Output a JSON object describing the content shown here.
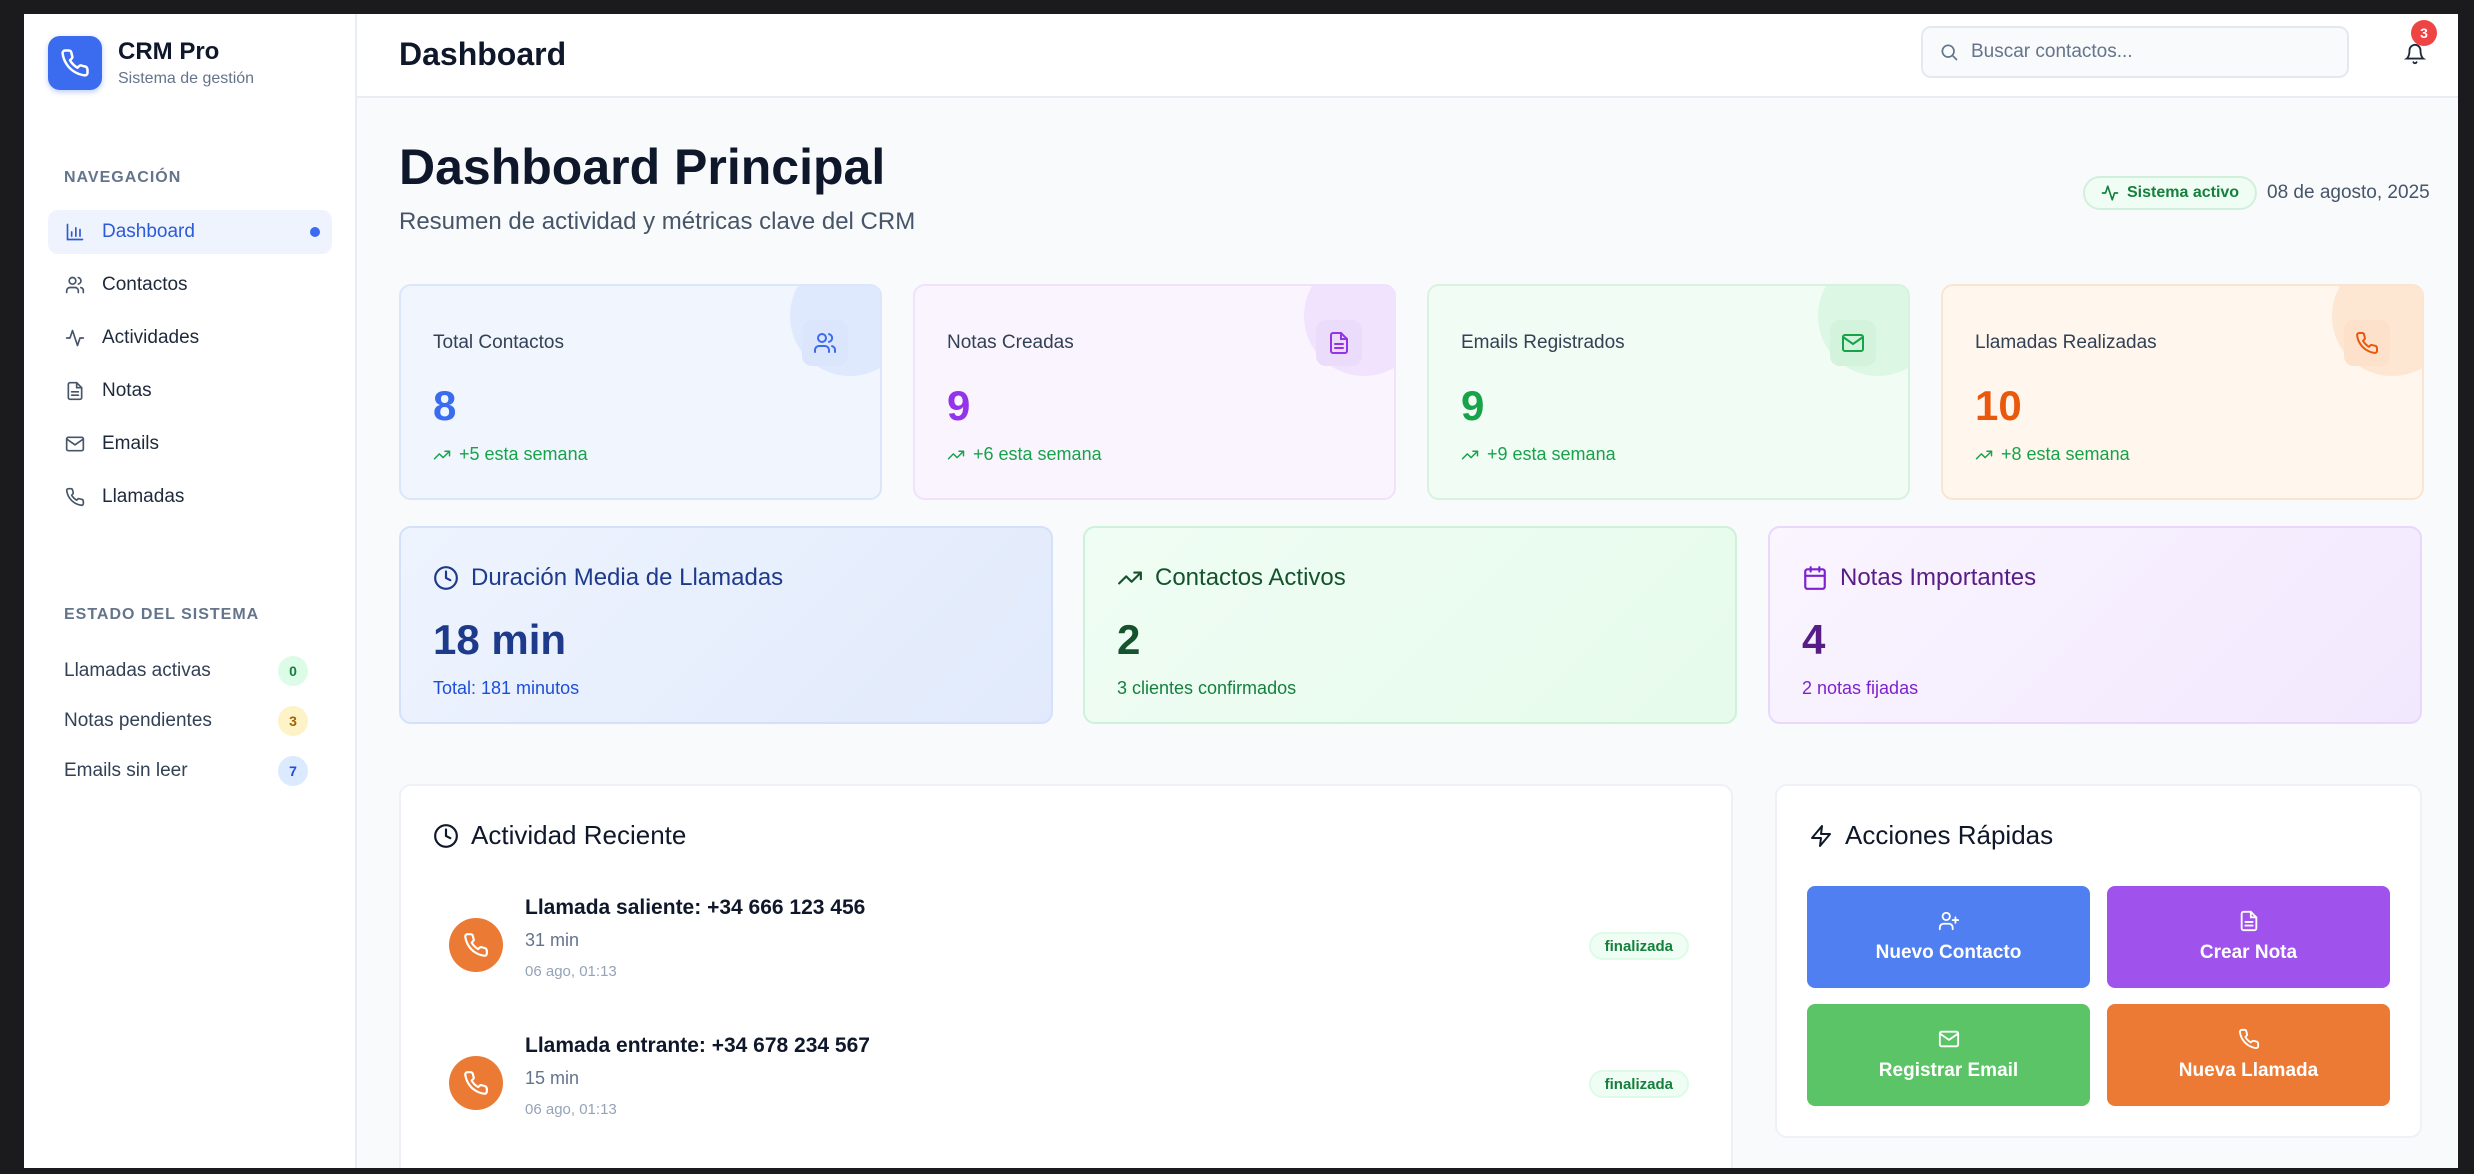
{
  "brand": {
    "name": "CRM Pro",
    "subtitle": "Sistema de gestión"
  },
  "sidebar": {
    "nav_title": "NAVEGACIÓN",
    "items": [
      {
        "label": "Dashboard",
        "icon": "bar-chart-icon",
        "active": true
      },
      {
        "label": "Contactos",
        "icon": "users-icon"
      },
      {
        "label": "Actividades",
        "icon": "activity-icon"
      },
      {
        "label": "Notas",
        "icon": "file-text-icon"
      },
      {
        "label": "Emails",
        "icon": "mail-icon"
      },
      {
        "label": "Llamadas",
        "icon": "phone-icon"
      }
    ],
    "status_title": "ESTADO DEL SISTEMA",
    "status": [
      {
        "label": "Llamadas activas",
        "count": "0",
        "color": "#dcfce7",
        "text_color": "#15803d"
      },
      {
        "label": "Notas pendientes",
        "count": "3",
        "color": "#fef3c7",
        "text_color": "#a16207"
      },
      {
        "label": "Emails sin leer",
        "count": "7",
        "color": "#dbeafe",
        "text_color": "#1d4ed8"
      }
    ]
  },
  "header": {
    "title": "Dashboard",
    "search_placeholder": "Buscar contactos...",
    "notifications": "3"
  },
  "main": {
    "title": "Dashboard Principal",
    "subtitle": "Resumen de actividad y métricas clave del CRM",
    "system_status": "Sistema activo",
    "date": "08 de agosto, 2025"
  },
  "stats": [
    {
      "label": "Total Contactos",
      "value": "8",
      "trend": "+5 esta semana",
      "icon": "users-icon",
      "accent": "#3b6cf0"
    },
    {
      "label": "Notas Creadas",
      "value": "9",
      "trend": "+6 esta semana",
      "icon": "file-text-icon",
      "accent": "#9333ea"
    },
    {
      "label": "Emails Registrados",
      "value": "9",
      "trend": "+9 esta semana",
      "icon": "mail-icon",
      "accent": "#16a34a"
    },
    {
      "label": "Llamadas Realizadas",
      "value": "10",
      "trend": "+8 esta semana",
      "icon": "phone-icon",
      "accent": "#ea580c"
    }
  ],
  "metrics": [
    {
      "title": "Duración Media de Llamadas",
      "value": "18 min",
      "desc": "Total: 181 minutos",
      "icon": "clock-icon"
    },
    {
      "title": "Contactos Activos",
      "value": "2",
      "desc": "3 clientes confirmados",
      "icon": "trending-up-icon"
    },
    {
      "title": "Notas Importantes",
      "value": "4",
      "desc": "2 notas fijadas",
      "icon": "calendar-icon"
    }
  ],
  "recent_activity": {
    "title": "Actividad Reciente",
    "items": [
      {
        "title": "Llamada saliente: +34 666 123 456",
        "duration": "31 min",
        "time": "06 ago, 01:13",
        "status": "finalizada"
      },
      {
        "title": "Llamada entrante: +34 678 234 567",
        "duration": "15 min",
        "time": "06 ago, 01:13",
        "status": "finalizada"
      }
    ]
  },
  "quick_actions": {
    "title": "Acciones Rápidas",
    "buttons": [
      {
        "label": "Nuevo Contacto",
        "icon": "user-plus-icon",
        "color": "#4f7ff0"
      },
      {
        "label": "Crear Nota",
        "icon": "file-text-icon",
        "color": "#a052ec"
      },
      {
        "label": "Registrar Email",
        "icon": "mail-icon",
        "color": "#5ac467"
      },
      {
        "label": "Nueva Llamada",
        "icon": "phone-icon",
        "color": "#ec7a34"
      }
    ]
  }
}
